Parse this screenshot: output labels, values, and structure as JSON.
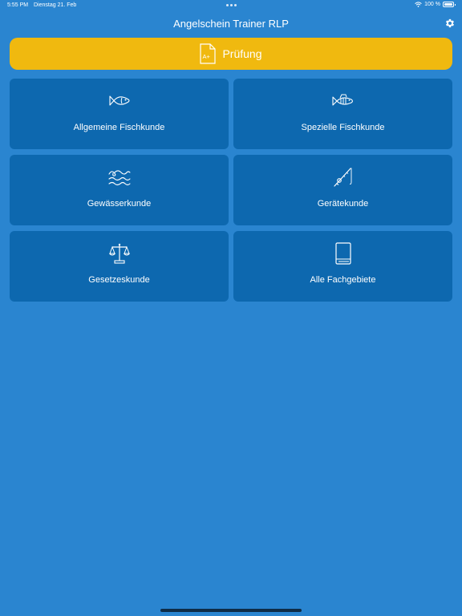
{
  "status_bar": {
    "time": "5:55 PM",
    "date": "Dienstag 21. Feb",
    "battery": "100 %",
    "battery_level": 1.0
  },
  "nav": {
    "title": "Angelschein Trainer RLP",
    "settings_icon": "gear-icon"
  },
  "exam": {
    "label": "Prüfung",
    "icon": "exam-document-icon",
    "icon_text": "A+",
    "color": "#f0b90f"
  },
  "tiles": [
    {
      "label": "Allgemeine Fischkunde",
      "icon": "fish-icon"
    },
    {
      "label": "Spezielle Fischkunde",
      "icon": "perch-icon"
    },
    {
      "label": "Gewässerkunde",
      "icon": "waves-icon"
    },
    {
      "label": "Gerätekunde",
      "icon": "fishing-rod-icon"
    },
    {
      "label": "Gesetzeskunde",
      "icon": "scales-icon"
    },
    {
      "label": "Alle Fachgebiete",
      "icon": "book-icon"
    }
  ],
  "colors": {
    "background": "#2a85d0",
    "tile": "#0d68af",
    "accent": "#f0b90f"
  }
}
